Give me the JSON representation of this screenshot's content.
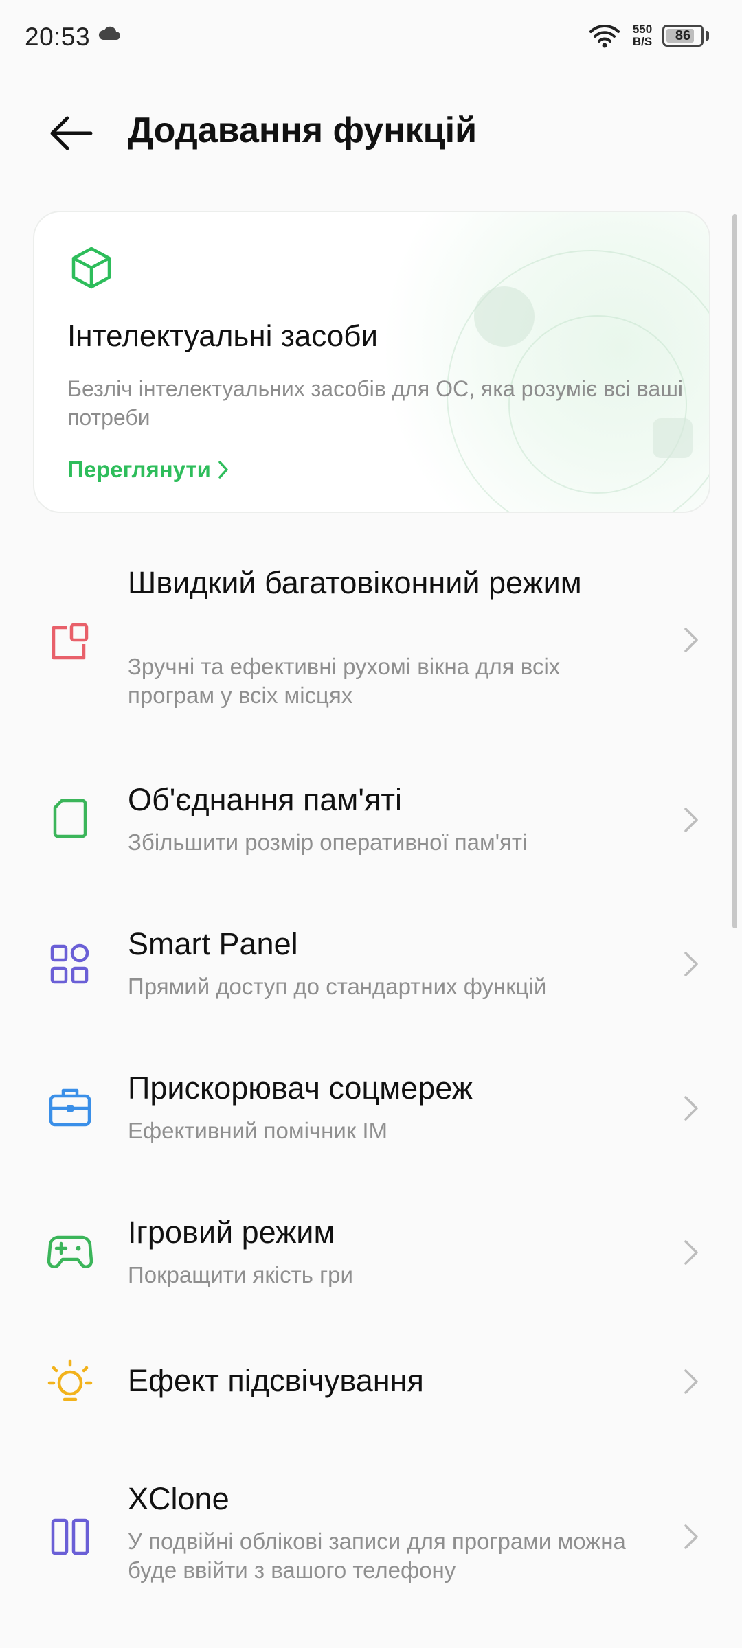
{
  "status_bar": {
    "time": "20:53",
    "net_speed_value": "550",
    "net_speed_unit": "B/S",
    "battery": "86",
    "battery_level": 0.86,
    "icons": [
      "cloud-icon",
      "wifi-icon",
      "battery-icon"
    ]
  },
  "header": {
    "title": "Додавання функцій",
    "back_icon": "arrow-left-icon"
  },
  "card": {
    "title": "Інтелектуальні засоби",
    "description": "Безліч інтелектуальних засобів для ОС, яка розуміє всі ваші потреби",
    "link_label": "Переглянути",
    "icon": "cube-icon",
    "accent_color": "#2ebd5b"
  },
  "items": [
    {
      "label": "Швидкий багатовіконний режим",
      "description": "Зручні та ефективні рухомі вікна для всіх програм у всіх місцях",
      "icon": "floating-window-icon",
      "color": "#e8606a"
    },
    {
      "label": "Об'єднання пам'яті",
      "description": "Збільшити розмір оперативної пам'яті",
      "icon": "memory-card-icon",
      "color": "#3bb55a"
    },
    {
      "label": "Smart Panel",
      "description": "Прямий доступ до стандартних функцій",
      "icon": "grid-icon",
      "color": "#6a5fd6"
    },
    {
      "label": "Прискорювач соцмереж",
      "description": "Ефективний помічник IM",
      "icon": "toolbox-icon",
      "color": "#3a8fe8"
    },
    {
      "label": "Ігровий режим",
      "description": "Покращити якість гри",
      "icon": "gamepad-icon",
      "color": "#3bb55a"
    },
    {
      "label": "Ефект підсвічування",
      "description": "",
      "icon": "lightbulb-icon",
      "color": "#f2b21b"
    },
    {
      "label": "XClone",
      "description": "У подвійні облікові записи для програми можна буде ввійти з вашого телефону",
      "icon": "dual-apps-icon",
      "color": "#6a5fd6"
    }
  ]
}
